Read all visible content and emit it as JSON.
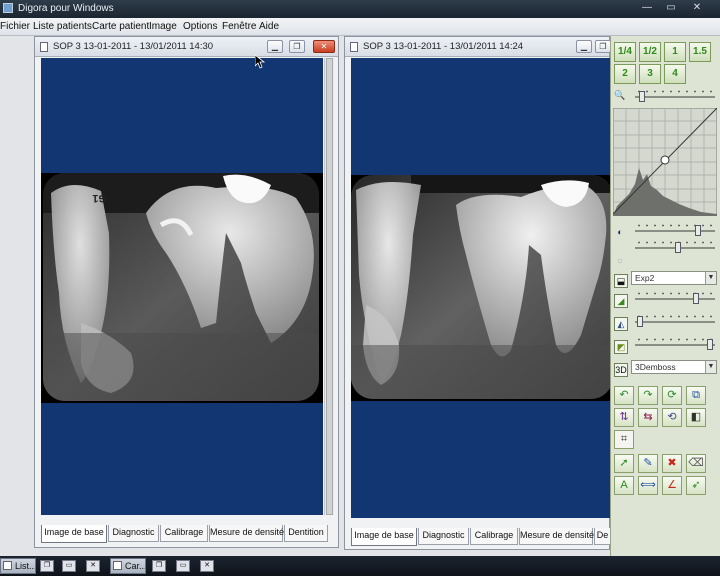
{
  "window": {
    "title": "Digora pour Windows",
    "controls": [
      "—",
      "▭",
      "✕"
    ]
  },
  "menu": [
    "Fichier",
    "Liste patients",
    "Carte patient",
    "Image",
    "Options",
    "Fenêtre",
    "Aide"
  ],
  "image_windows": [
    {
      "title": "SOP 3 13-01-2011 - 13/01/2011 14:30",
      "tabs": [
        "Image de base",
        "Diagnostic",
        "Calibrage",
        "Mesure de densité",
        "Dentition"
      ],
      "active_tab": "Image de base"
    },
    {
      "title": "SOP 3 13-01-2011 - 13/01/2011 14:24",
      "tabs": [
        "Image de base",
        "Diagnostic",
        "Calibrage",
        "Mesure de densité",
        "De"
      ],
      "active_tab": "Image de base"
    }
  ],
  "xray_label": "G1",
  "toolpanel": {
    "zoom_row1": [
      "1/4",
      "1/2",
      "1",
      "1.5"
    ],
    "zoom_row2": [
      "2",
      "3",
      "4"
    ],
    "filter_dropdown": "Exp2",
    "emboss_dropdown": "3Demboss"
  },
  "taskbar": [
    {
      "label": "List..."
    },
    {
      "label": "Car..."
    }
  ],
  "colors": {
    "viewer_background": "#113672",
    "panel_background": "#dee4d3",
    "zoom_text": "#2f8a1c"
  }
}
